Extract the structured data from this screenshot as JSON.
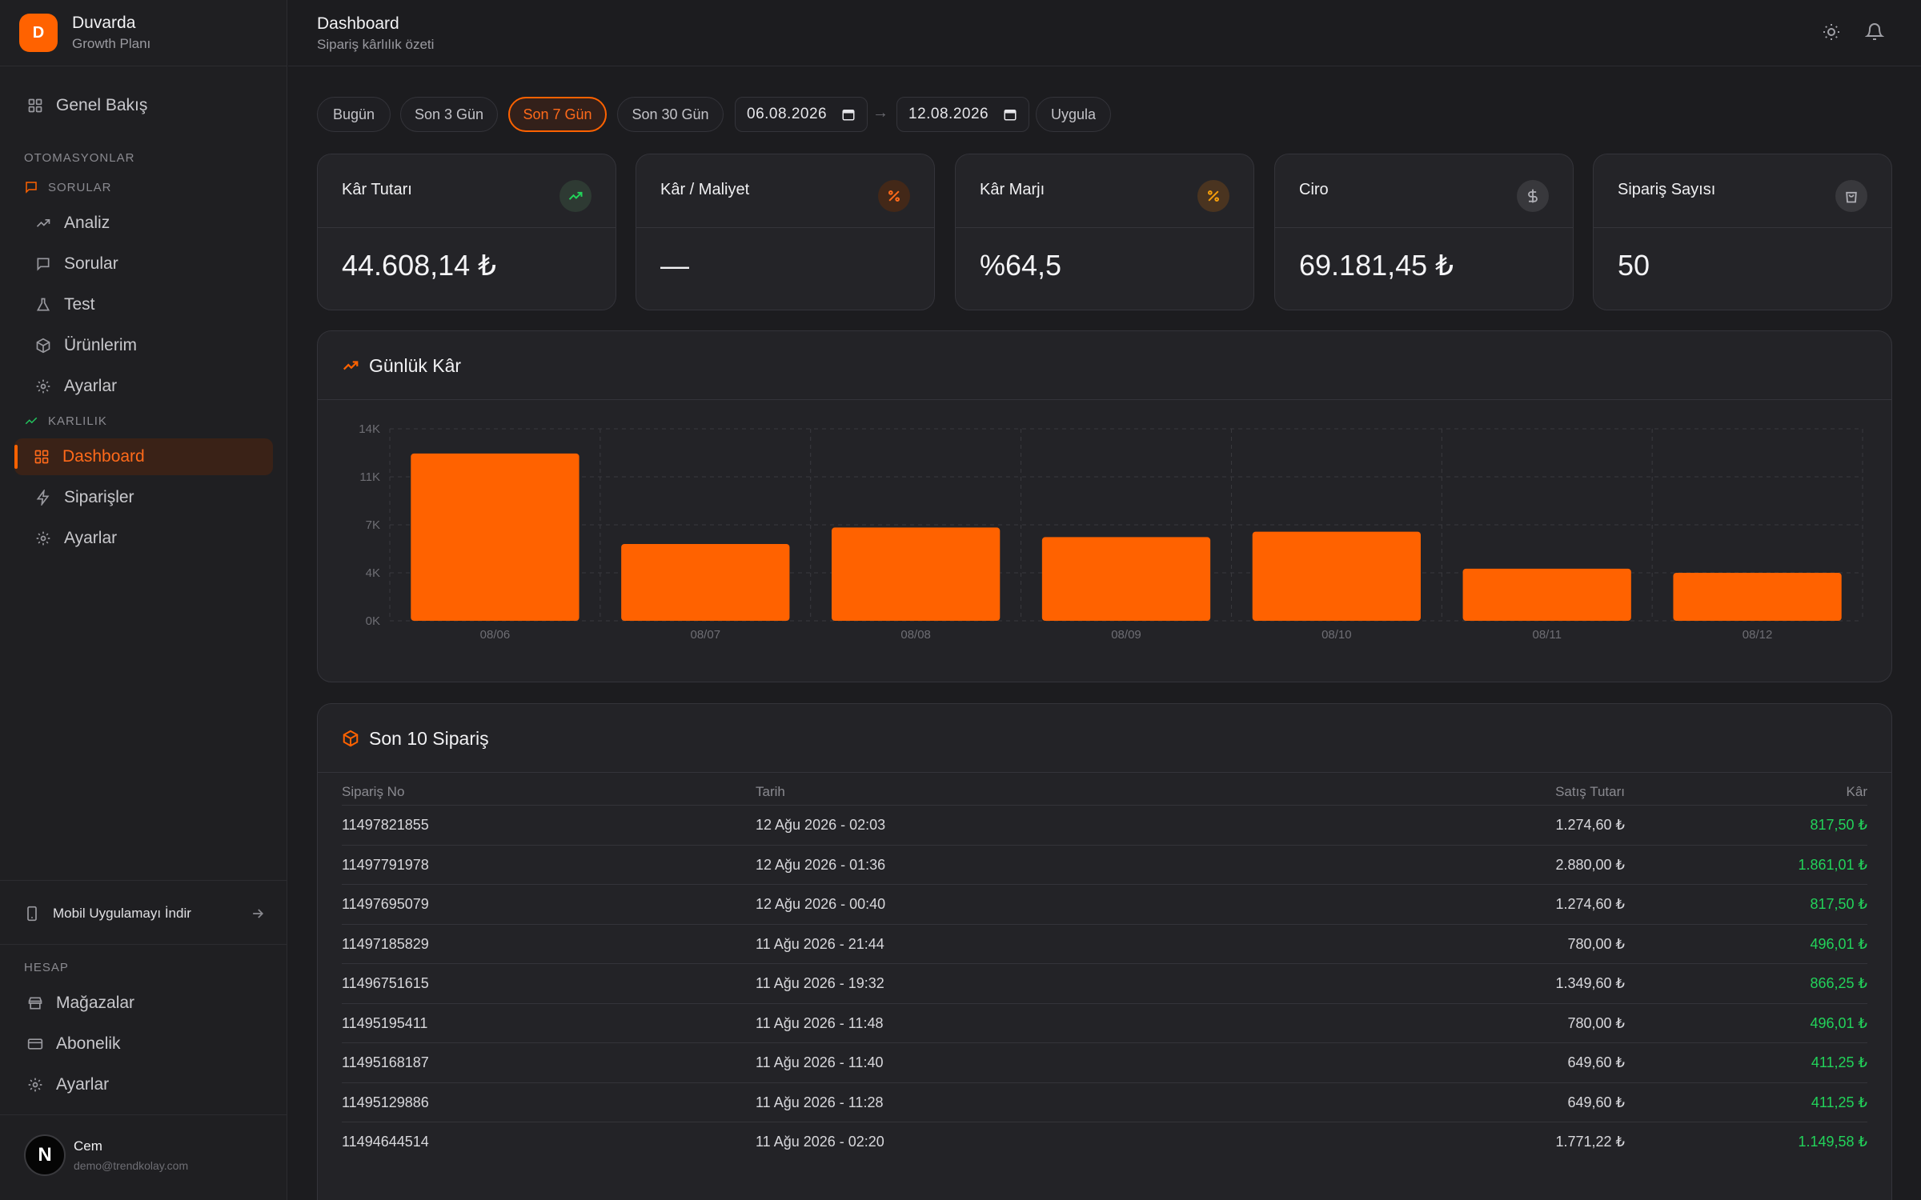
{
  "brand": {
    "initial": "D",
    "name": "Duvarda",
    "plan": "Growth Planı"
  },
  "sidebar": {
    "overview": "Genel Bakış",
    "section_automations": "OTOMASYONLAR",
    "group_questions": "SORULAR",
    "questions_items": [
      "Analiz",
      "Sorular",
      "Test",
      "Ürünlerim",
      "Ayarlar"
    ],
    "group_profitability": "KARLILIK",
    "profit_items": [
      "Dashboard",
      "Siparişler",
      "Ayarlar"
    ],
    "mobile_app": "Mobil Uygulamayı İndir",
    "section_account": "HESAP",
    "account_items": [
      "Mağazalar",
      "Abonelik",
      "Ayarlar"
    ]
  },
  "user": {
    "initial": "N",
    "name": "Cem",
    "email": "demo@trendkolay.com"
  },
  "header": {
    "title": "Dashboard",
    "subtitle": "Sipariş kârlılık özeti"
  },
  "filters": {
    "ranges": [
      "Bugün",
      "Son 3 Gün",
      "Son 7 Gün",
      "Son 30 Gün"
    ],
    "active_range": "Son 7 Gün",
    "start_date": "06.08.2026",
    "end_date": "12.08.2026",
    "arrow": "→",
    "apply": "Uygula"
  },
  "stats": [
    {
      "title": "Kâr Tutarı",
      "value": "44.608,14 ₺",
      "icon": "trending-up-icon"
    },
    {
      "title": "Kâr / Maliyet",
      "value": "—",
      "icon": "percent-icon"
    },
    {
      "title": "Kâr Marjı",
      "value": "%64,5",
      "icon": "percent-icon"
    },
    {
      "title": "Ciro",
      "value": "69.181,45 ₺",
      "icon": "dollar-icon"
    },
    {
      "title": "Sipariş Sayısı",
      "value": "50",
      "icon": "shopping-bag-icon"
    }
  ],
  "colors": {
    "accent": "#ff6200",
    "profit": "#22d35a",
    "background": "#1c1c1f",
    "card": "#242428"
  },
  "chart_data": {
    "type": "bar",
    "title": "Günlük Kâr",
    "categories": [
      "08/06",
      "08/07",
      "08/08",
      "08/09",
      "08/10",
      "08/11",
      "08/12"
    ],
    "values": [
      12200,
      5600,
      6800,
      6100,
      6500,
      3800,
      3500
    ],
    "yticks": [
      "0K",
      "4K",
      "7K",
      "11K",
      "14K"
    ],
    "ylim": [
      0,
      14000
    ],
    "grid": true,
    "color": "#ff6200"
  },
  "orders": {
    "title": "Son 10 Sipariş",
    "columns": [
      "Sipariş No",
      "Tarih",
      "Satış Tutarı",
      "Kâr"
    ],
    "rows": [
      [
        "11497821855",
        "12 Ağu 2026 - 02:03",
        "1.274,60 ₺",
        "817,50 ₺"
      ],
      [
        "11497791978",
        "12 Ağu 2026 - 01:36",
        "2.880,00 ₺",
        "1.861,01 ₺"
      ],
      [
        "11497695079",
        "12 Ağu 2026 - 00:40",
        "1.274,60 ₺",
        "817,50 ₺"
      ],
      [
        "11497185829",
        "11 Ağu 2026 - 21:44",
        "780,00 ₺",
        "496,01 ₺"
      ],
      [
        "11496751615",
        "11 Ağu 2026 - 19:32",
        "1.349,60 ₺",
        "866,25 ₺"
      ],
      [
        "11495195411",
        "11 Ağu 2026 - 11:48",
        "780,00 ₺",
        "496,01 ₺"
      ],
      [
        "11495168187",
        "11 Ağu 2026 - 11:40",
        "649,60 ₺",
        "411,25 ₺"
      ],
      [
        "11495129886",
        "11 Ağu 2026 - 11:28",
        "649,60 ₺",
        "411,25 ₺"
      ],
      [
        "11494644514",
        "11 Ağu 2026 - 02:20",
        "1.771,22 ₺",
        "1.149,58 ₺"
      ]
    ]
  }
}
